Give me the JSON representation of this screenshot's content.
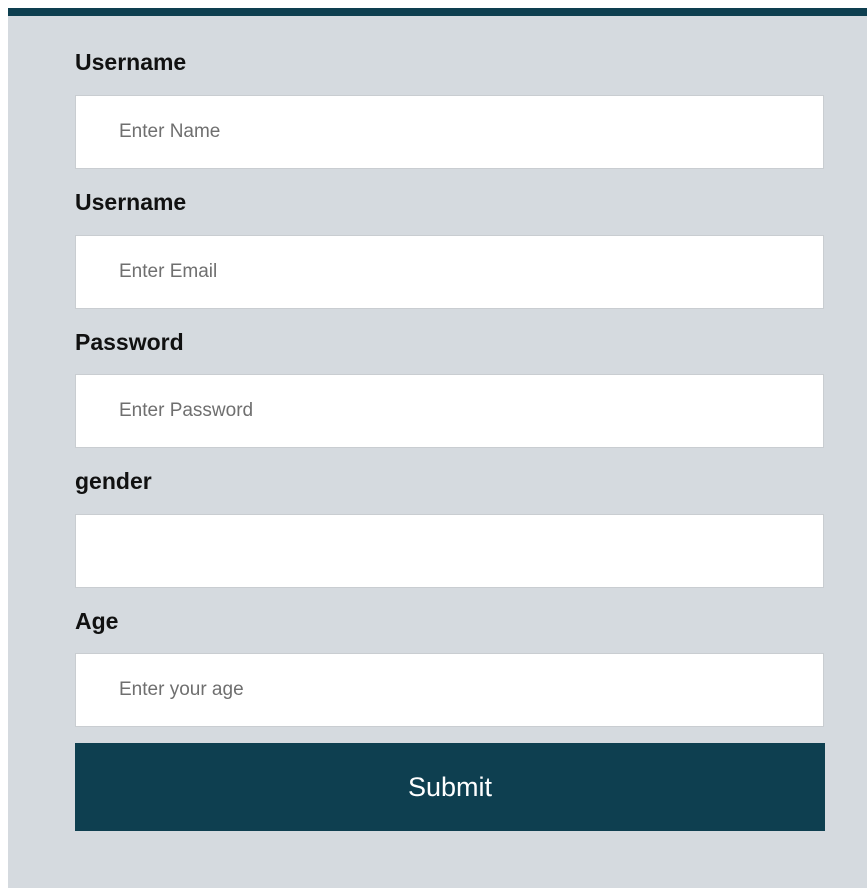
{
  "form": {
    "fields": [
      {
        "label": "Username",
        "placeholder": "Enter Name",
        "value": ""
      },
      {
        "label": "Username",
        "placeholder": "Enter Email",
        "value": ""
      },
      {
        "label": "Password",
        "placeholder": "Enter Password",
        "value": ""
      },
      {
        "label": "gender",
        "placeholder": "",
        "value": ""
      },
      {
        "label": "Age",
        "placeholder": "Enter your age",
        "value": ""
      }
    ],
    "submit_label": "Submit"
  },
  "colors": {
    "accent": "#0e3f50",
    "panel_background": "#d5dadf",
    "input_background": "#ffffff"
  }
}
